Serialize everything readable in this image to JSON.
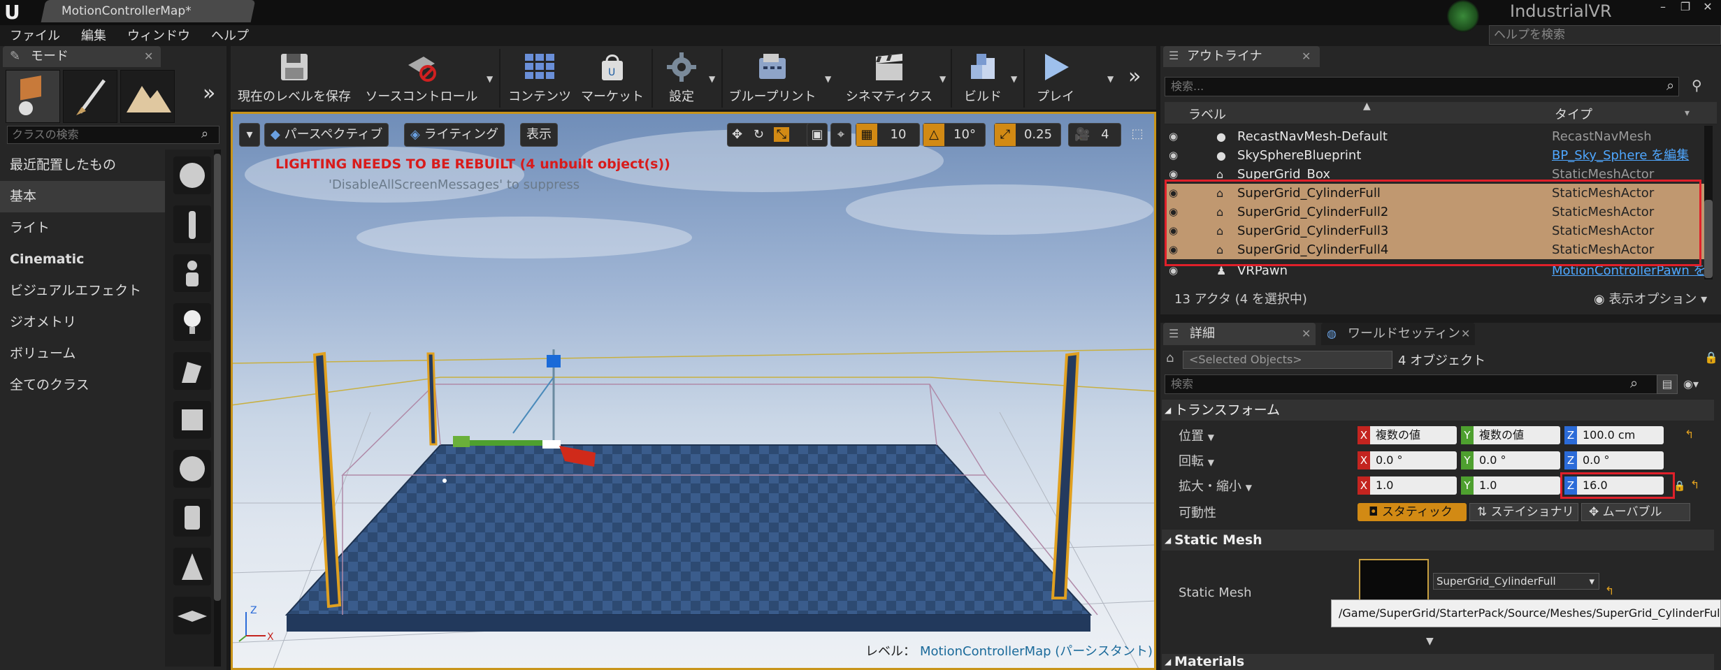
{
  "window": {
    "tab_title": "MotionControllerMap*",
    "project_name": "IndustrialVR",
    "help_search_placeholder": "ヘルプを検索",
    "minimize": "–",
    "maximize": "❐",
    "close": "✕"
  },
  "menu": [
    "ファイル",
    "編集",
    "ウィンドウ",
    "ヘルプ"
  ],
  "modes": {
    "tab_label": "モード",
    "class_search_placeholder": "クラスの検索",
    "categories": [
      "最近配置したもの",
      "基本",
      "ライト",
      "Cinematic",
      "ビジュアルエフェクト",
      "ジオメトリ",
      "ボリューム",
      "全てのクラス"
    ],
    "selected_category": "基本"
  },
  "toolbar": {
    "save": "現在のレベルを保存",
    "source_control": "ソースコントロール",
    "content": "コンテンツ",
    "market": "マーケット",
    "settings": "設定",
    "blueprint": "ブループリント",
    "cinematics": "シネマティクス",
    "build": "ビルド",
    "play": "プレイ"
  },
  "viewport": {
    "perspective": "パースペクティブ",
    "lighting": "ライティング",
    "show": "表示",
    "grid_snap": "10",
    "rotation_snap": "10°",
    "scale_snap": "0.25",
    "camera_speed": "4",
    "warning": "LIGHTING NEEDS TO BE REBUILT (4 unbuilt object(s))",
    "suppress_hint": "'DisableAllScreenMessages' to suppress",
    "level_label": "レベル：",
    "level_name": "MotionControllerMap (パーシスタント)"
  },
  "outliner": {
    "tab_label": "アウトライナ",
    "search_placeholder": "検索...",
    "col_label": "ラベル",
    "col_type": "タイプ",
    "rows": [
      {
        "name": "RecastNavMesh-Default",
        "type": "RecastNavMesh",
        "icon": "navmesh-icon",
        "selected": false
      },
      {
        "name": "SkySphereBlueprint",
        "type": "BP_Sky_Sphere を編集",
        "icon": "sphere-icon",
        "selected": false,
        "link": true
      },
      {
        "name": "SuperGrid_Box",
        "type": "StaticMeshActor",
        "icon": "mesh-icon",
        "selected": false
      },
      {
        "name": "SuperGrid_CylinderFull",
        "type": "StaticMeshActor",
        "icon": "mesh-icon",
        "selected": true
      },
      {
        "name": "SuperGrid_CylinderFull2",
        "type": "StaticMeshActor",
        "icon": "mesh-icon",
        "selected": true
      },
      {
        "name": "SuperGrid_CylinderFull3",
        "type": "StaticMeshActor",
        "icon": "mesh-icon",
        "selected": true
      },
      {
        "name": "SuperGrid_CylinderFull4",
        "type": "StaticMeshActor",
        "icon": "mesh-icon",
        "selected": true
      },
      {
        "name": "VRPawn",
        "type": "MotionControllerPawn を",
        "icon": "pawn-icon",
        "selected": false,
        "link": true
      }
    ],
    "actor_count": "13 アクタ (4 を選択中)",
    "view_options": "表示オプション"
  },
  "details": {
    "tab_label": "詳細",
    "world_tab_label": "ワールドセッティン",
    "selected_objects": "<Selected Objects>",
    "object_count": "4 オブジェクト",
    "search_placeholder": "検索",
    "transform_section": "トランスフォーム",
    "location": {
      "label": "位置",
      "x": "複数の値",
      "y": "複数の値",
      "z": "100.0 cm"
    },
    "rotation": {
      "label": "回転",
      "x": "0.0 °",
      "y": "0.0 °",
      "z": "0.0 °"
    },
    "scale": {
      "label": "拡大・縮小",
      "x": "1.0",
      "y": "1.0",
      "z": "16.0"
    },
    "mobility": {
      "label": "可動性",
      "static": "スタティック",
      "stationary": "ステイショナリ",
      "movable": "ムーバブル"
    },
    "static_mesh_section": "Static Mesh",
    "static_mesh_label": "Static Mesh",
    "static_mesh_value": "SuperGrid_CylinderFull",
    "tooltip_path": "/Game/SuperGrid/StarterPack/Source/Meshes/SuperGrid_CylinderFull",
    "materials_section": "Materials"
  },
  "colors": {
    "selection": "#c09870",
    "highlight_box": "#e0202a",
    "viewport_border": "#c8941a",
    "warning": "#d81b1b",
    "link": "#4fa7ff"
  }
}
